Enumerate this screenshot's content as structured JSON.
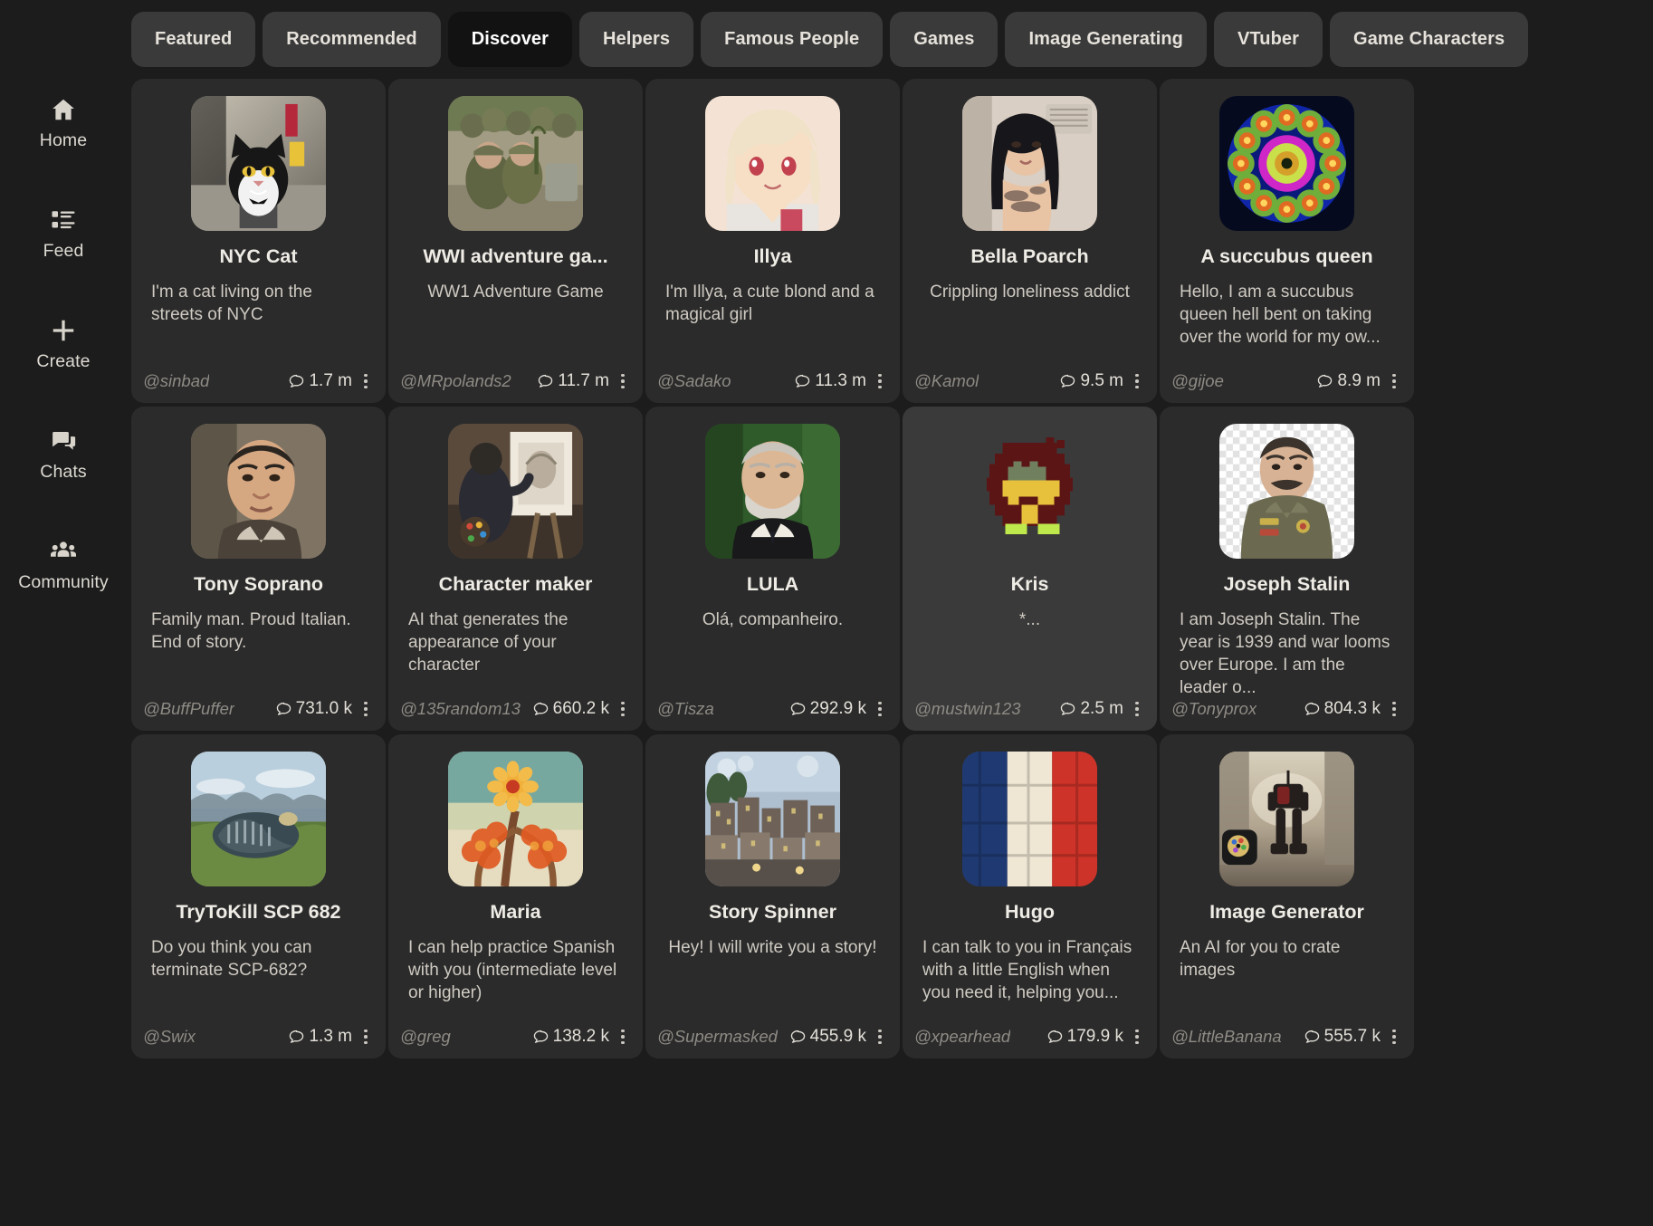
{
  "sidebar": {
    "items": [
      {
        "label": "Home",
        "icon": "home-icon"
      },
      {
        "label": "Feed",
        "icon": "feed-icon"
      },
      {
        "label": "Create",
        "icon": "plus-icon"
      },
      {
        "label": "Chats",
        "icon": "chat-icon"
      },
      {
        "label": "Community",
        "icon": "community-icon"
      }
    ]
  },
  "tabs": [
    {
      "label": "Featured",
      "active": false
    },
    {
      "label": "Recommended",
      "active": false
    },
    {
      "label": "Discover",
      "active": true
    },
    {
      "label": "Helpers",
      "active": false
    },
    {
      "label": "Famous People",
      "active": false
    },
    {
      "label": "Games",
      "active": false
    },
    {
      "label": "Image Generating",
      "active": false
    },
    {
      "label": "VTuber",
      "active": false
    },
    {
      "label": "Game Characters",
      "active": false
    }
  ],
  "cards": [
    {
      "title": "NYC Cat",
      "desc": "I'm a cat living on the streets of NYC",
      "handle": "@sinbad",
      "count": "1.7 m",
      "align": "left",
      "art": "nyc-cat",
      "hovered": false
    },
    {
      "title": "WWI adventure ga...",
      "desc": "WW1 Adventure Game",
      "handle": "@MRpolands2",
      "count": "11.7 m",
      "align": "center",
      "art": "wwi",
      "hovered": false
    },
    {
      "title": "Illya",
      "desc": "I'm Illya, a cute blond and a magical girl",
      "handle": "@Sadako",
      "count": "11.3 m",
      "align": "left",
      "art": "illya",
      "hovered": false
    },
    {
      "title": "Bella Poarch",
      "desc": "Crippling loneliness addict",
      "handle": "@Kamol",
      "count": "9.5 m",
      "align": "center",
      "art": "bella",
      "hovered": false
    },
    {
      "title": "A succubus queen",
      "desc": "Hello, I am a succubus queen hell bent on taking over the world for my ow...",
      "handle": "@gijoe",
      "count": "8.9 m",
      "align": "left",
      "art": "succubus",
      "hovered": false
    },
    {
      "title": "Tony Soprano",
      "desc": "Family man. Proud Italian. End of story.",
      "handle": "@BuffPuffer",
      "count": "731.0 k",
      "align": "left",
      "art": "tony",
      "hovered": false
    },
    {
      "title": "Character maker",
      "desc": "AI that generates the appearance of your character",
      "handle": "@135random13",
      "count": "660.2 k",
      "align": "left",
      "art": "charmaker",
      "hovered": false
    },
    {
      "title": "LULA",
      "desc": "Olá, companheiro.",
      "handle": "@Tisza",
      "count": "292.9 k",
      "align": "center",
      "art": "lula",
      "hovered": false
    },
    {
      "title": "Kris",
      "desc": "*...",
      "handle": "@mustwin123",
      "count": "2.5 m",
      "align": "center",
      "art": "kris",
      "hovered": true
    },
    {
      "title": "Joseph Stalin",
      "desc": "I am Joseph Stalin. The year is 1939 and war looms over Europe. I am the leader o...",
      "handle": "@Tonyprox",
      "count": "804.3 k",
      "align": "left",
      "art": "stalin",
      "hovered": false
    },
    {
      "title": "TryToKill SCP 682",
      "desc": "Do you think you can terminate SCP-682?",
      "handle": "@Swix",
      "count": "1.3 m",
      "align": "left",
      "art": "scp",
      "hovered": false
    },
    {
      "title": "Maria",
      "desc": "I can help practice Spanish with you (intermediate level or higher)",
      "handle": "@greg",
      "count": "138.2 k",
      "align": "left",
      "art": "maria",
      "hovered": false
    },
    {
      "title": "Story Spinner",
      "desc": "Hey! I will write you a story!",
      "handle": "@Supermasked",
      "count": "455.9 k",
      "align": "center",
      "art": "story",
      "hovered": false
    },
    {
      "title": "Hugo",
      "desc": "I can talk to you in Français with a little English when you need it, helping you...",
      "handle": "@xpearhead",
      "count": "179.9 k",
      "align": "left",
      "art": "hugo",
      "hovered": false
    },
    {
      "title": "Image Generator",
      "desc": "An AI for you to crate images",
      "handle": "@LittleBanana",
      "count": "555.7 k",
      "align": "left",
      "art": "imagegen",
      "hovered": false
    }
  ],
  "colors": {
    "background": "#1c1c1c",
    "card": "#2b2b2b",
    "card_hover": "#3a3a3a",
    "tab": "#3a3a3a",
    "tab_active": "#121212",
    "text_primary": "#efece6",
    "text_secondary": "#cfcac2",
    "text_muted": "#8f8b85"
  }
}
